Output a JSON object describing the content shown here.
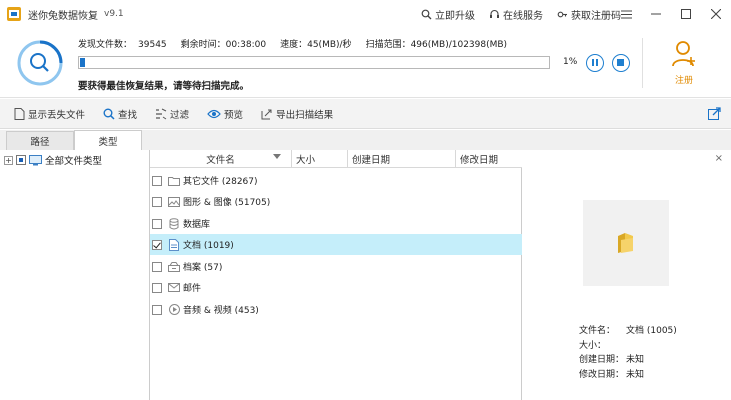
{
  "app": {
    "title": "迷你兔数据恢复",
    "version": "v9.1"
  },
  "title_actions": [
    {
      "icon": "search-icon",
      "label": "立即升级"
    },
    {
      "icon": "headset-icon",
      "label": "在线服务"
    },
    {
      "icon": "key-icon",
      "label": "获取注册码"
    }
  ],
  "window_controls": [
    "menu-icon",
    "minimize-icon",
    "maximize-icon",
    "close-icon"
  ],
  "scan": {
    "found_label": "发现文件数：",
    "found_value": "39545",
    "remaining_label": "剩余时间：",
    "remaining_value": "00:38:00",
    "speed_label": "速度：",
    "speed_value": "45(MB)/秒",
    "range_label": "扫描范围：",
    "range_value": "496(MB)/102398(MB)",
    "progress_percent": 1,
    "progress_text": "1%",
    "message": "要获得最佳恢复结果，请等待扫描完成。",
    "register_label": "注册"
  },
  "toolbar": [
    {
      "name": "show-lost-files-button",
      "icon": "file-icon",
      "label": "显示丢失文件"
    },
    {
      "name": "find-button",
      "icon": "search-icon",
      "label": "查找"
    },
    {
      "name": "filter-button",
      "icon": "filter-icon",
      "label": "过滤"
    },
    {
      "name": "preview-button",
      "icon": "eye-icon",
      "label": "预览"
    },
    {
      "name": "export-scan-button",
      "icon": "export-icon",
      "label": "导出扫描结果"
    }
  ],
  "tabs": [
    {
      "label": "路径",
      "active": false
    },
    {
      "label": "类型",
      "active": true
    }
  ],
  "tree": {
    "expander": "+",
    "root_label": "全部文件类型"
  },
  "columns": {
    "name": "文件名",
    "size": "大小",
    "created": "创建日期",
    "modified": "修改日期"
  },
  "rows": [
    {
      "icon": "folder-icon",
      "label": "其它文件 (28267)",
      "checked": false,
      "selected": false
    },
    {
      "icon": "image-icon",
      "label": "图形 & 图像 (51705)",
      "checked": false,
      "selected": false
    },
    {
      "icon": "database-icon",
      "label": "数据库",
      "checked": false,
      "selected": false
    },
    {
      "icon": "document-icon",
      "label": "文档 (1019)",
      "checked": true,
      "selected": true
    },
    {
      "icon": "archive-icon",
      "label": "档案 (57)",
      "checked": false,
      "selected": false
    },
    {
      "icon": "mail-icon",
      "label": "邮件",
      "checked": false,
      "selected": false
    },
    {
      "icon": "media-icon",
      "label": "音频 & 视频 (453)",
      "checked": false,
      "selected": false
    }
  ],
  "preview": {
    "close": "×",
    "info": [
      {
        "key": "文件名：",
        "value": "文档 (1005)"
      },
      {
        "key": "大小：",
        "value": ""
      },
      {
        "key": "创建日期：",
        "value": "未知"
      },
      {
        "key": "修改日期：",
        "value": "未知"
      }
    ]
  },
  "colors": {
    "accent": "#1a73c8",
    "selected_row": "#c5eefa",
    "register": "#e08a00"
  }
}
